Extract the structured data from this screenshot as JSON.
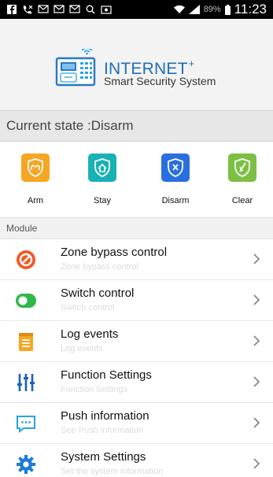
{
  "status_bar": {
    "battery": "89%",
    "time": "11:23"
  },
  "brand": {
    "title": "INTERNET",
    "title_sup": "+",
    "subtitle": "Smart Security System"
  },
  "state": {
    "text": "Current state :Disarm"
  },
  "actions": [
    {
      "label": "Arm",
      "color": "#f5a623",
      "icon": "arm-shield-icon"
    },
    {
      "label": "Stay",
      "color": "#1ab1b5",
      "icon": "stay-house-icon"
    },
    {
      "label": "Disarm",
      "color": "#2a6fe0",
      "icon": "disarm-x-shield-icon"
    },
    {
      "label": "Clear",
      "color": "#7bc043",
      "icon": "clear-shield-icon"
    }
  ],
  "module": {
    "header": "Module",
    "items": [
      {
        "title": "Zone bypass control",
        "subtitle": "Zone bypass control",
        "icon": "bypass-icon"
      },
      {
        "title": "Switch control",
        "subtitle": "Switch control",
        "icon": "toggle-switch-icon"
      },
      {
        "title": "Log events",
        "subtitle": "Log events",
        "icon": "log-notepad-icon"
      },
      {
        "title": "Function Settings",
        "subtitle": "Function Settings",
        "icon": "sliders-icon"
      },
      {
        "title": "Push information",
        "subtitle": "See Push information",
        "icon": "chat-bubble-icon"
      },
      {
        "title": "System Settings",
        "subtitle": "Set the system information",
        "icon": "gear-icon"
      }
    ]
  }
}
